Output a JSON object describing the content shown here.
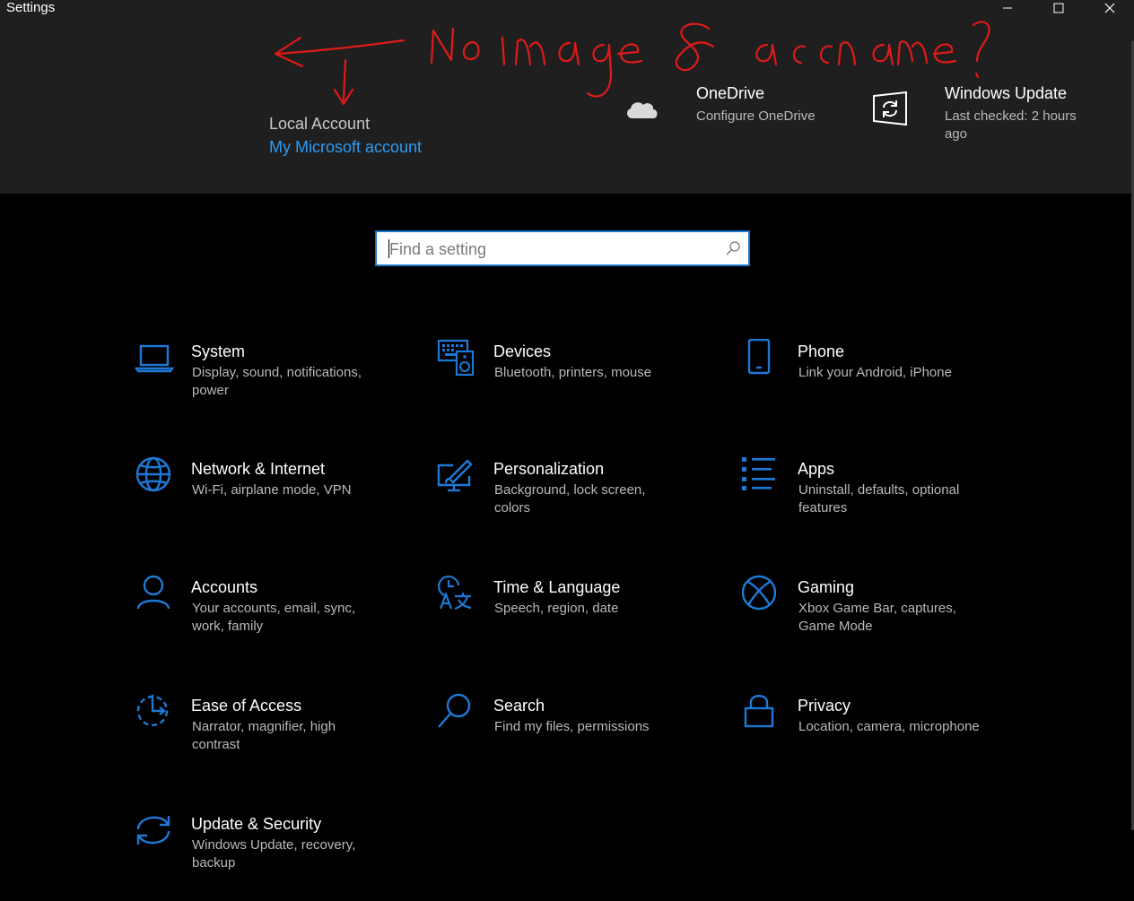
{
  "window": {
    "title": "Settings",
    "controls": [
      "minimize",
      "maximize",
      "close"
    ]
  },
  "header": {
    "account_type": "Local Account",
    "microsoft_account_link": "My Microsoft account",
    "onedrive": {
      "title": "OneDrive",
      "subtitle": "Configure OneDrive",
      "icon": "cloud-icon"
    },
    "windows_update": {
      "title": "Windows Update",
      "subtitle": "Last checked: 2 hours ago",
      "icon": "windows-update-icon"
    },
    "annotation": {
      "text": "No image & acc name ?",
      "color": "#e01a1a"
    }
  },
  "search": {
    "placeholder": "Find a setting",
    "value": ""
  },
  "colors": {
    "accent": "#1a73c8",
    "icon_blue": "#1e79d6",
    "link": "#2e9cf4",
    "header_bg": "#1f1f1f",
    "annotation": "#e01a1a"
  },
  "categories": [
    {
      "id": "system",
      "name": "System",
      "desc": "Display, sound, notifications, power",
      "icon": "laptop-icon"
    },
    {
      "id": "devices",
      "name": "Devices",
      "desc": "Bluetooth, printers, mouse",
      "icon": "keyboard-speaker-icon"
    },
    {
      "id": "phone",
      "name": "Phone",
      "desc": "Link your Android, iPhone",
      "icon": "phone-icon"
    },
    {
      "id": "network",
      "name": "Network & Internet",
      "desc": "Wi-Fi, airplane mode, VPN",
      "icon": "globe-icon"
    },
    {
      "id": "personalization",
      "name": "Personalization",
      "desc": "Background, lock screen, colors",
      "icon": "paint-brush-icon"
    },
    {
      "id": "apps",
      "name": "Apps",
      "desc": "Uninstall, defaults, optional features",
      "icon": "list-icon"
    },
    {
      "id": "accounts",
      "name": "Accounts",
      "desc": "Your accounts, email, sync, work, family",
      "icon": "person-icon"
    },
    {
      "id": "time",
      "name": "Time & Language",
      "desc": "Speech, region, date",
      "icon": "clock-language-icon"
    },
    {
      "id": "gaming",
      "name": "Gaming",
      "desc": "Xbox Game Bar, captures, Game Mode",
      "icon": "xbox-icon"
    },
    {
      "id": "ease",
      "name": "Ease of Access",
      "desc": "Narrator, magnifier, high contrast",
      "icon": "ease-of-access-icon"
    },
    {
      "id": "search",
      "name": "Search",
      "desc": "Find my files, permissions",
      "icon": "search-icon"
    },
    {
      "id": "privacy",
      "name": "Privacy",
      "desc": "Location, camera, microphone",
      "icon": "lock-icon"
    },
    {
      "id": "update",
      "name": "Update & Security",
      "desc": "Windows Update, recovery, backup",
      "icon": "sync-icon"
    }
  ]
}
